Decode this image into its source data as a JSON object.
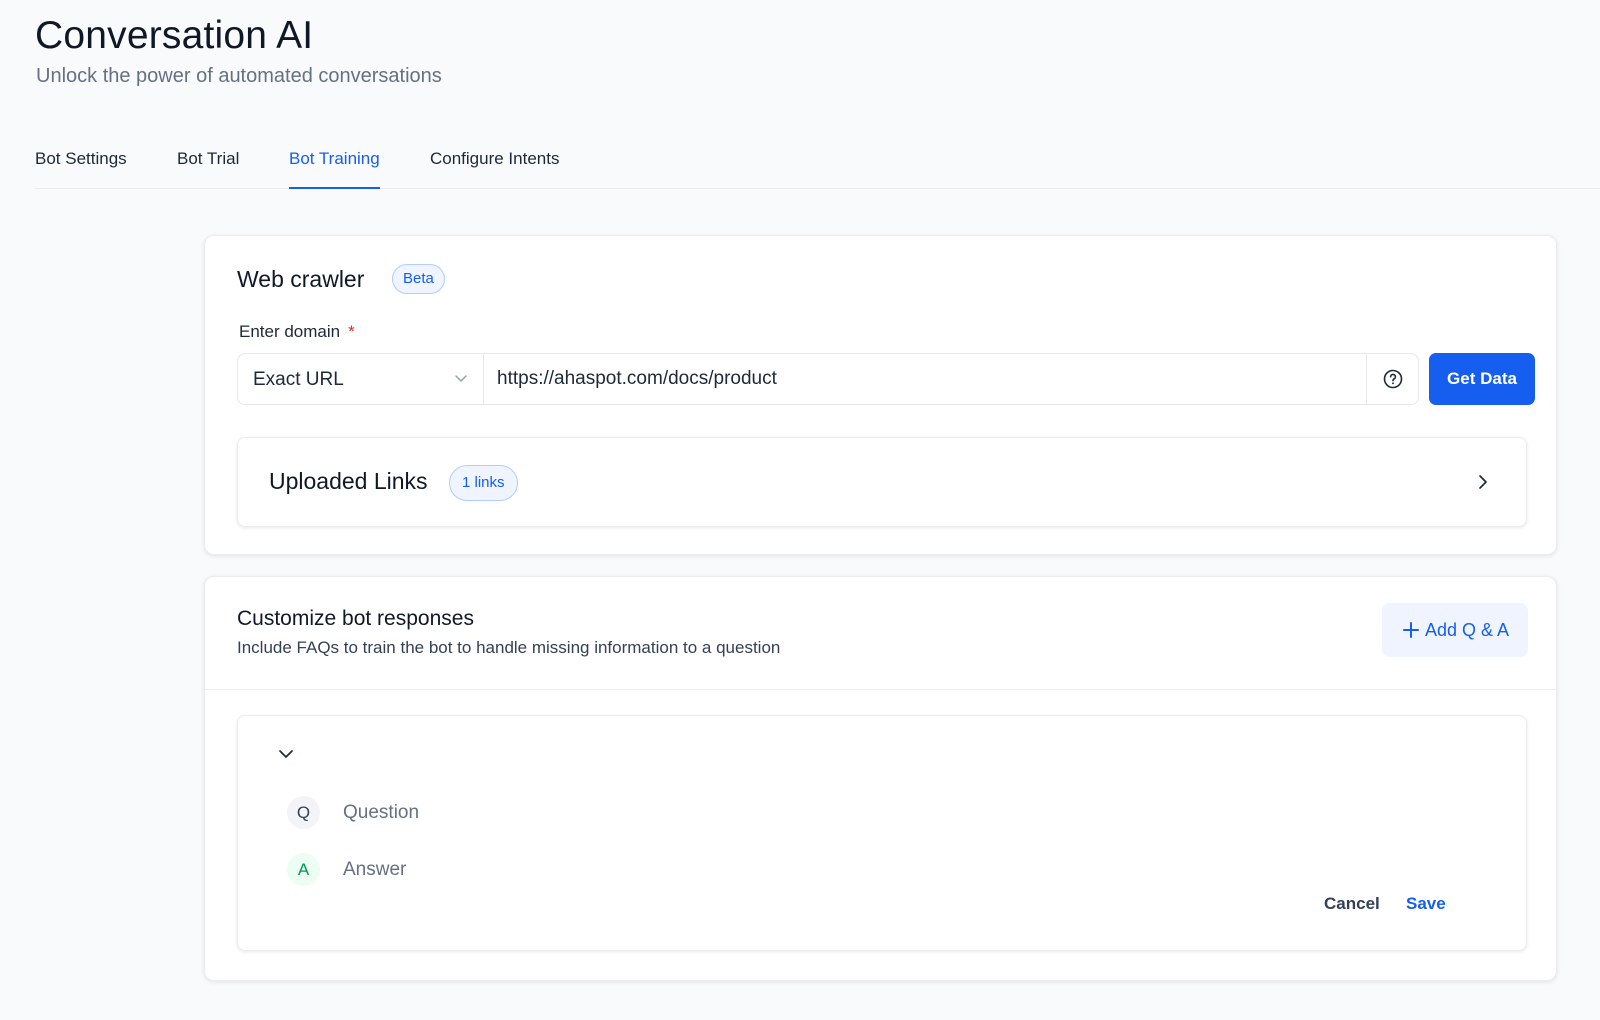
{
  "header": {
    "title": "Conversation AI",
    "subtitle": "Unlock the power of automated conversations"
  },
  "tabs": [
    {
      "label": "Bot Settings",
      "active": false
    },
    {
      "label": "Bot Trial",
      "active": false
    },
    {
      "label": "Bot Training",
      "active": true
    },
    {
      "label": "Configure Intents",
      "active": false
    }
  ],
  "web_crawler": {
    "title": "Web crawler",
    "badge": "Beta",
    "field_label": "Enter domain",
    "required_marker": "*",
    "match_type": "Exact URL",
    "url_value": "https://ahaspot.com/docs/product",
    "get_data_label": "Get Data",
    "uploaded_links": {
      "title": "Uploaded Links",
      "count_badge": "1 links"
    }
  },
  "customize": {
    "title": "Customize bot responses",
    "description": "Include FAQs to train the bot to handle missing information to a question",
    "add_button_label": "Add Q & A",
    "qa_item": {
      "question_marker": "Q",
      "question_placeholder": "Question",
      "answer_marker": "A",
      "answer_placeholder": "Answer",
      "cancel_label": "Cancel",
      "save_label": "Save"
    }
  },
  "colors": {
    "accent": "#155eef",
    "badge_bg": "#eff4ff",
    "required": "#d92d20",
    "answer_green": "#039855"
  },
  "icons": {
    "select_chevron": "chevron-down-icon",
    "help": "help-circle-icon",
    "uploaded_expand": "chevron-right-icon",
    "add": "plus-icon",
    "collapse": "chevron-down-icon"
  }
}
